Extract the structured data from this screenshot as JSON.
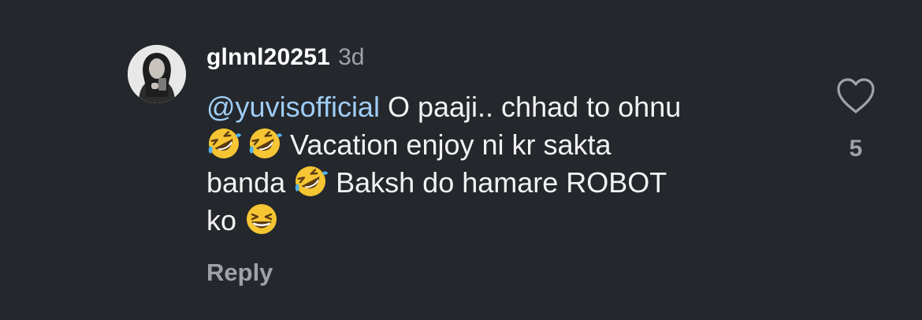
{
  "comment": {
    "username": "glnnl20251",
    "timestamp": "3d",
    "mention": "@yuvisofficial",
    "segments": {
      "part1": " O paaji.. chhad to ohnu",
      "part2": " Vacation enjoy ni kr sakta",
      "part3": "banda ",
      "part4": " Baksh do hamare ROBOT",
      "part5": "ko "
    },
    "emojis": [
      "rolling-on-floor-laughing",
      "rolling-on-floor-laughing",
      "rolling-on-floor-laughing",
      "grinning-squinting-face"
    ],
    "reply_label": "Reply",
    "like_count": "5"
  },
  "colors": {
    "background": "#24272b",
    "mention": "#9fcdf6",
    "secondary_text": "#9ea3a8"
  },
  "icons": {
    "like": "heart-outline-icon"
  }
}
